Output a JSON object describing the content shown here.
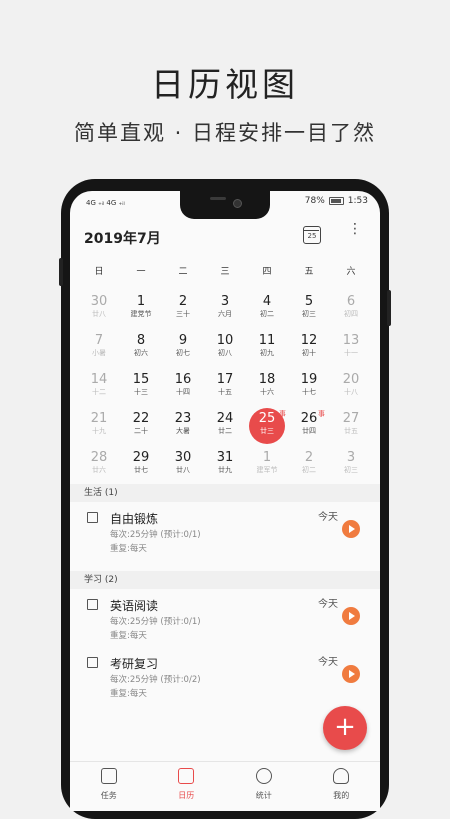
{
  "promo": {
    "title": "日历视图",
    "subtitle": "简单直观 · 日程安排一目了然"
  },
  "status_bar": {
    "signal": "4G ₊ᵢₗ 4G ₊ᵢₗ",
    "battery": "78%",
    "battery_level": 0.78,
    "time": "1:53"
  },
  "header": {
    "month_title": "2019年7月",
    "today_icon_label": "25",
    "today_icon": "calendar-today-icon",
    "more_icon": "more-vertical-icon"
  },
  "weekdays": [
    "日",
    "一",
    "二",
    "三",
    "四",
    "五",
    "六"
  ],
  "calendar": {
    "weeks": [
      [
        {
          "num": "30",
          "lunar": "廿八",
          "dim": true
        },
        {
          "num": "1",
          "lunar": "建党节"
        },
        {
          "num": "2",
          "lunar": "三十"
        },
        {
          "num": "3",
          "lunar": "六月"
        },
        {
          "num": "4",
          "lunar": "初二"
        },
        {
          "num": "5",
          "lunar": "初三"
        },
        {
          "num": "6",
          "lunar": "初四",
          "dim": true
        }
      ],
      [
        {
          "num": "7",
          "lunar": "小暑",
          "dim": true
        },
        {
          "num": "8",
          "lunar": "初六"
        },
        {
          "num": "9",
          "lunar": "初七"
        },
        {
          "num": "10",
          "lunar": "初八"
        },
        {
          "num": "11",
          "lunar": "初九"
        },
        {
          "num": "12",
          "lunar": "初十"
        },
        {
          "num": "13",
          "lunar": "十一",
          "dim": true
        }
      ],
      [
        {
          "num": "14",
          "lunar": "十二",
          "dim": true
        },
        {
          "num": "15",
          "lunar": "十三"
        },
        {
          "num": "16",
          "lunar": "十四"
        },
        {
          "num": "17",
          "lunar": "十五"
        },
        {
          "num": "18",
          "lunar": "十六"
        },
        {
          "num": "19",
          "lunar": "十七"
        },
        {
          "num": "20",
          "lunar": "十八",
          "dim": true
        }
      ],
      [
        {
          "num": "21",
          "lunar": "十九",
          "dim": true
        },
        {
          "num": "22",
          "lunar": "二十"
        },
        {
          "num": "23",
          "lunar": "大暑"
        },
        {
          "num": "24",
          "lunar": "廿二"
        },
        {
          "num": "25",
          "lunar": "廿三",
          "selected": true,
          "event": "事"
        },
        {
          "num": "26",
          "lunar": "廿四",
          "event": "事"
        },
        {
          "num": "27",
          "lunar": "廿五",
          "dim": true
        }
      ],
      [
        {
          "num": "28",
          "lunar": "廿六",
          "dim": true
        },
        {
          "num": "29",
          "lunar": "廿七"
        },
        {
          "num": "30",
          "lunar": "廿八"
        },
        {
          "num": "31",
          "lunar": "廿九"
        },
        {
          "num": "1",
          "lunar": "建军节",
          "dim": true
        },
        {
          "num": "2",
          "lunar": "初二",
          "dim": true
        },
        {
          "num": "3",
          "lunar": "初三",
          "dim": true
        }
      ]
    ]
  },
  "sections": [
    {
      "title": "生活 (1)",
      "tasks": [
        {
          "name": "自由锻炼",
          "meta1": "每次:25分钟  (预计:0/1)",
          "meta2": "重复:每天",
          "when": "今天"
        }
      ]
    },
    {
      "title": "学习 (2)",
      "tasks": [
        {
          "name": "英语阅读",
          "meta1": "每次:25分钟  (预计:0/1)",
          "meta2": "重复:每天",
          "when": "今天"
        },
        {
          "name": "考研复习",
          "meta1": "每次:25分钟  (预计:0/2)",
          "meta2": "重复:每天",
          "when": "今天"
        }
      ]
    }
  ],
  "fab": {
    "label": "+"
  },
  "tabbar": [
    {
      "label": "任务",
      "icon": "task-list-icon"
    },
    {
      "label": "日历",
      "icon": "calendar-icon",
      "active": true
    },
    {
      "label": "统计",
      "icon": "pie-chart-icon"
    },
    {
      "label": "我的",
      "icon": "user-icon"
    }
  ],
  "colors": {
    "accent": "#e84b4b",
    "play": "#f07b3f"
  }
}
